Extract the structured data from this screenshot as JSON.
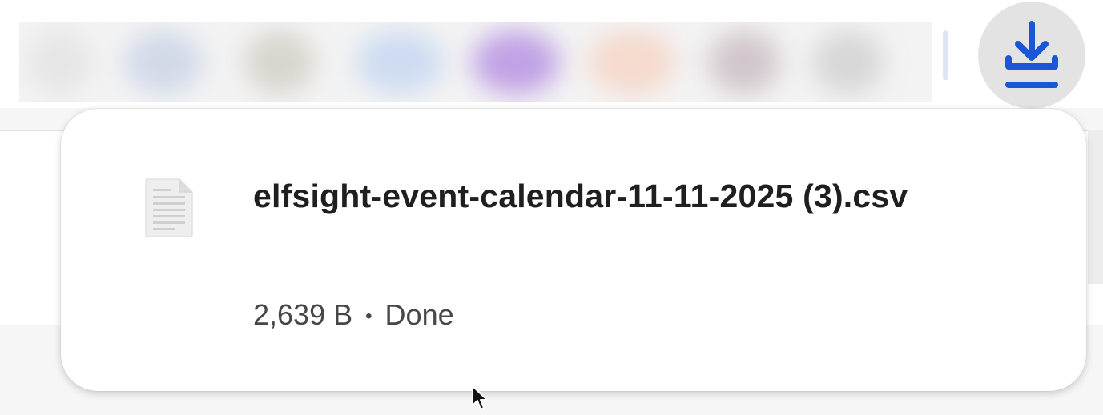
{
  "toolbar": {
    "download_button_label": "Downloads",
    "download_icon": "download-icon"
  },
  "extensions_strip": {
    "blurred": true,
    "blob_colors": [
      "#e6e6e6",
      "#c9d3e6",
      "#d6d2c8",
      "#bfd3f0",
      "#b58ee0",
      "#f5d2c2",
      "#c4b8c0",
      "#c9c9c9",
      "#e3e3e3"
    ]
  },
  "download_bubble": {
    "items": [
      {
        "file_icon": "file-icon",
        "file_name": "elfsight-event-calendar-11-11-2025 (3).csv",
        "size": "2,639 B",
        "separator": "•",
        "status": "Done"
      }
    ]
  },
  "colors": {
    "accent_blue": "#1a57d6",
    "button_bg": "#e3e3e3",
    "text_primary": "#1f1f1f",
    "text_secondary": "#474747"
  }
}
